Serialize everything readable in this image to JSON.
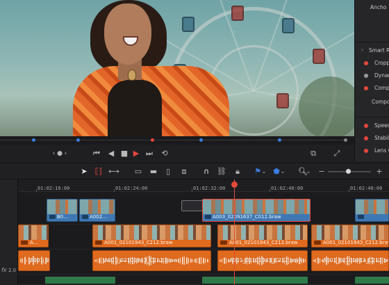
{
  "inspector": {
    "items": [
      {
        "label": "Ancho",
        "dot": "none"
      },
      {
        "label": "Smart Re",
        "dot": "chevron"
      },
      {
        "label": "Croppi",
        "dot": "on"
      },
      {
        "label": "Dynam",
        "dot": "off"
      },
      {
        "label": "Compo",
        "dot": "on"
      },
      {
        "label": "Compos",
        "dot": "none"
      },
      {
        "label": "Speed",
        "dot": "on"
      },
      {
        "label": "Stabili",
        "dot": "on"
      },
      {
        "label": "Lens C",
        "dot": "on"
      }
    ]
  },
  "transport": {
    "buttons": [
      "prev-clip",
      "play-reverse",
      "stop",
      "play",
      "next-clip",
      "loop"
    ],
    "nav_label": "‹ ● ›"
  },
  "timeline": {
    "timecodes": [
      "01:02:16:00",
      "01:02:24:00",
      "01:02:32:00",
      "01:02:40:00",
      "01:02:48:00"
    ],
    "fx_label": "fx",
    "fx_value": "2.0",
    "video_track_2": [
      {
        "label": "B0..."
      },
      {
        "label": "A002..."
      },
      {
        "label": ""
      },
      {
        "label": "A003_02091637_C012.braw"
      },
      {
        "label": ""
      }
    ],
    "video_track_1": [
      {
        "label": "A..."
      },
      {
        "label": "A001_02101943_C212.braw"
      },
      {
        "label": "A001_02101943_C212.braw"
      },
      {
        "label": "A001_02101943_C212.braw"
      }
    ],
    "audio_track_1": [
      {
        "label": "A001_0..."
      },
      {
        "label": "A001_02101943_C212.braw"
      },
      {
        "label": "A001_02101943_C212.braw"
      },
      {
        "label": "A001_02101943_C212.braw"
      }
    ]
  },
  "colors": {
    "accent_red": "#e5483a",
    "clip_blue": "#3e78b4",
    "clip_orange": "#e06a1e"
  }
}
